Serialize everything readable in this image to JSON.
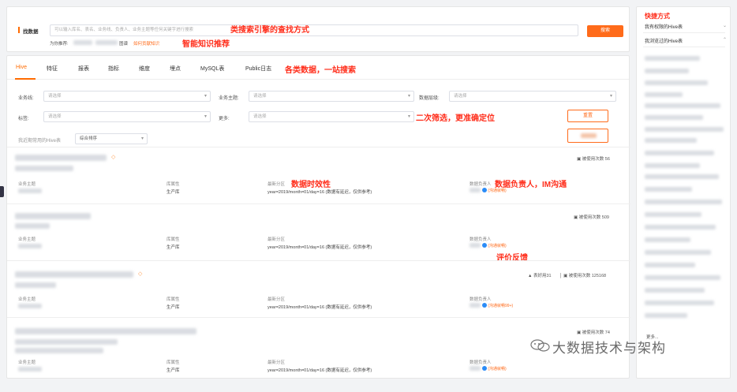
{
  "search": {
    "label": "找数据",
    "placeholder": "可以输入库名、表名、业务线、负责人、业务主题等任何关键字进行搜索",
    "button": "搜索",
    "annotation": "类搜索引擎的查找方式",
    "recommend_prefix": "为你推荐:",
    "recommend_mid": "图谱",
    "recommend_link": "如何贡献知识",
    "recommend_annotation": "智能知识推荐"
  },
  "tabs": [
    "Hive",
    "特征",
    "报表",
    "指标",
    "维度",
    "埋点",
    "MySQL表",
    "Public日志"
  ],
  "tabs_annotation": "各类数据，一站搜索",
  "filters": {
    "business_line": "业务线:",
    "business_topic": "业务主题:",
    "data_layer": "数据层级:",
    "tag": "标签:",
    "more": "更多:",
    "placeholder": "请选择",
    "reset": "重置",
    "annotation": "二次筛选，更准确定位",
    "recent_label": "我近期常用的Hive表",
    "sort": "综合排序"
  },
  "results": [
    {
      "usage": "被使用次数 56",
      "biz_label": "业务主题",
      "attr_label": "库属性",
      "attr_value": "生产库",
      "part_label": "最新分区",
      "part_value": "year=2019/month=01/day=16 (数据有延迟，仅供参考)",
      "owner_label": "数据负责人",
      "im": "(沟通就畅)"
    },
    {
      "usage": "被使用次数 509",
      "biz_label": "业务主题",
      "attr_label": "库属性",
      "attr_value": "生产库",
      "part_label": "最新分区",
      "part_value": "year=2019/month=01/day=16 (数据有延迟，仅供参考)",
      "owner_label": "数据负责人",
      "im": "(沟通就畅)"
    },
    {
      "usage": "被使用次数 125168",
      "likes": "表好用31",
      "biz_label": "业务主题",
      "attr_label": "库属性",
      "attr_value": "生产库",
      "part_label": "最新分区",
      "part_value": "year=2019/month=01/day=16 (数据有延迟，仅供参考)",
      "owner_label": "数据负责人",
      "im": "(沟通就畅99+)"
    },
    {
      "usage": "被使用次数 74",
      "biz_label": "业务主题",
      "attr_label": "库属性",
      "attr_value": "生产库",
      "part_label": "最新分区",
      "part_value": "year=2019/month=01/day=16 (数据有延迟，仅供参考)",
      "owner_label": "数据负责人",
      "im": "(沟通就畅)"
    }
  ],
  "annotations": {
    "freshness": "数据时效性",
    "owner_im": "数据负责人，IM沟通",
    "feedback": "评价反馈"
  },
  "sidebar": {
    "title": "快捷方式",
    "item1": "我有权限的Hive表",
    "item2": "我浏览过的Hive表",
    "more": "更多..."
  },
  "watermark": "大数据技术与架构",
  "colors": {
    "accent": "#ff6b1a",
    "annotation": "#ff2d1a"
  }
}
